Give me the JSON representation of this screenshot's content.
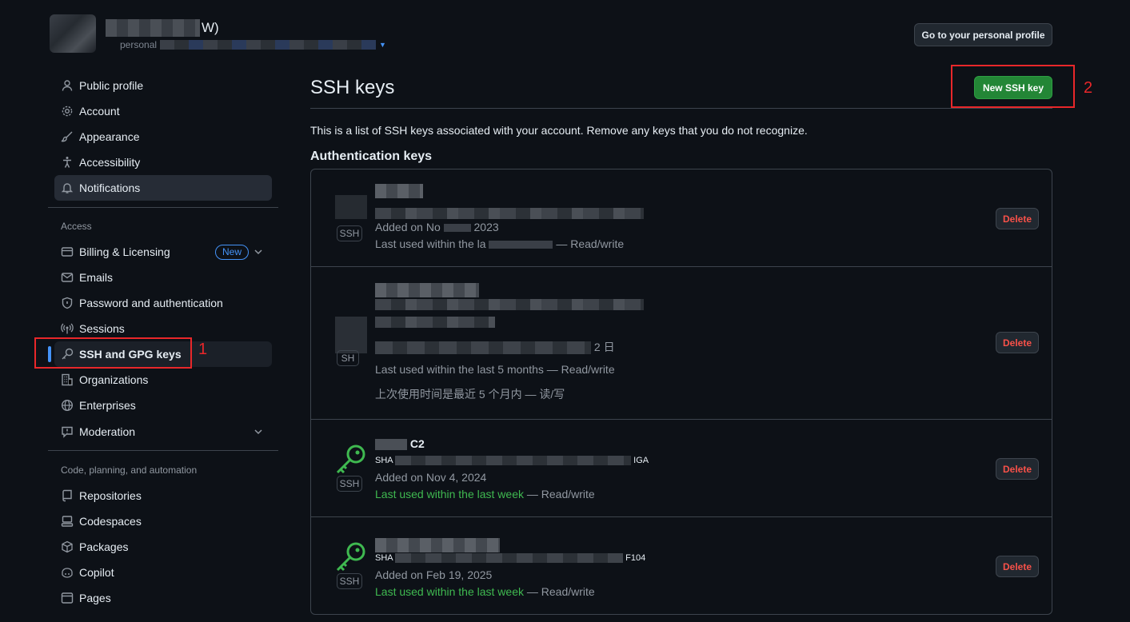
{
  "header": {
    "name_suffix": "W)",
    "sub_text": "personal",
    "profile_button": "Go to your personal profile"
  },
  "sidebar": {
    "top_items": [
      {
        "label": "Public profile",
        "icon": "person-icon"
      },
      {
        "label": "Account",
        "icon": "gear-icon"
      },
      {
        "label": "Appearance",
        "icon": "paintbrush-icon"
      },
      {
        "label": "Accessibility",
        "icon": "accessibility-icon"
      },
      {
        "label": "Notifications",
        "icon": "bell-icon"
      }
    ],
    "access_heading": "Access",
    "access_items": [
      {
        "label": "Billing & Licensing",
        "icon": "credit-card-icon",
        "badge": "New"
      },
      {
        "label": "Emails",
        "icon": "mail-icon"
      },
      {
        "label": "Password and authentication",
        "icon": "shield-lock-icon"
      },
      {
        "label": "Sessions",
        "icon": "broadcast-icon"
      },
      {
        "label": "SSH and GPG keys",
        "icon": "key-icon"
      },
      {
        "label": "Organizations",
        "icon": "organization-icon"
      },
      {
        "label": "Enterprises",
        "icon": "globe-icon"
      },
      {
        "label": "Moderation",
        "icon": "report-icon"
      }
    ],
    "code_heading": "Code, planning, and automation",
    "code_items": [
      {
        "label": "Repositories",
        "icon": "repo-icon"
      },
      {
        "label": "Codespaces",
        "icon": "codespaces-icon"
      },
      {
        "label": "Packages",
        "icon": "package-icon"
      },
      {
        "label": "Copilot",
        "icon": "copilot-icon"
      },
      {
        "label": "Pages",
        "icon": "browser-icon"
      }
    ]
  },
  "annotations": {
    "one": "1",
    "two": "2"
  },
  "main": {
    "title": "SSH keys",
    "new_key_button": "New SSH key",
    "intro": "This is a list of SSH keys associated with your account. Remove any keys that you do not recognize.",
    "auth_heading": "Authentication keys",
    "keys": [
      {
        "tag": "SSH",
        "added": "Added on No",
        "added_tail": "2023",
        "last_used_a": "Last used within the la",
        "last_used_green": "",
        "rw": "— Read/write",
        "delete": "Delete",
        "icon_color": "#9198a1"
      },
      {
        "tag": "SH",
        "added_zh_tail": "2 日",
        "last_used_a": "Last used within the last 5 months",
        "rw": "— Read/write",
        "zh_line": "上次使用时间是最近 5 个月内 — 读/写",
        "delete": "Delete"
      },
      {
        "tag": "SSH",
        "title_tail": "C2",
        "fp_prefix": "SHA",
        "fp_tail": "IGA",
        "added": "Added on Nov 4, 2024",
        "last_used_green": "Last used within the last week",
        "rw": "— Read/write",
        "delete": "Delete",
        "icon_color": "#3fb950"
      },
      {
        "tag": "SSH",
        "fp_prefix": "SHA",
        "fp_tail": "F104",
        "added": "Added on Feb 19, 2025",
        "last_used_green": "Last used within the last week",
        "rw": "— Read/write",
        "delete": "Delete",
        "icon_color": "#3fb950"
      }
    ]
  }
}
